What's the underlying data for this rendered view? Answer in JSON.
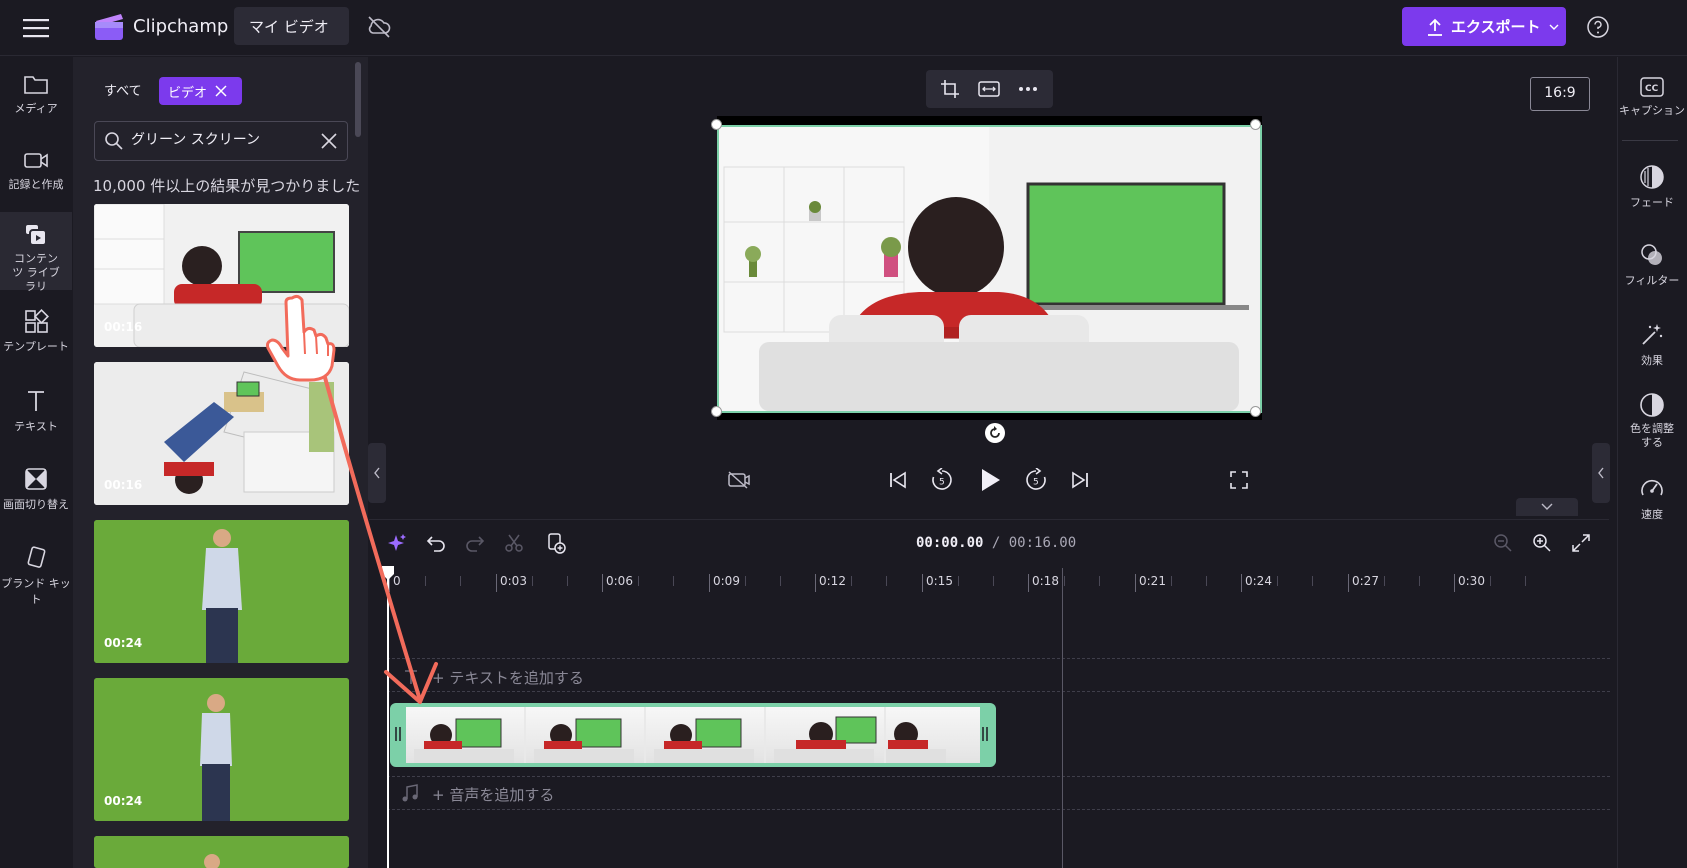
{
  "app": {
    "name": "Clipchamp",
    "project_title": "マイ ビデオ"
  },
  "header": {
    "export_label": "エクスポート"
  },
  "left_nav": [
    {
      "label": "メディア",
      "icon": "folder-icon"
    },
    {
      "label": "記録と作成",
      "icon": "camera-icon"
    },
    {
      "label": "コンテンツ ライブラリ",
      "icon": "content-library-icon",
      "active": true
    },
    {
      "label": "テンプレート",
      "icon": "template-icon"
    },
    {
      "label": "テキスト",
      "icon": "text-icon"
    },
    {
      "label": "画面切り替え",
      "icon": "transition-icon"
    },
    {
      "label": "ブランド キット",
      "icon": "brand-kit-icon"
    }
  ],
  "media_panel": {
    "filter_all": "すべて",
    "filter_video": "ビデオ",
    "search_value": "グリーン スクリーン",
    "results_text": "10,000 件以上の結果が見つかりました",
    "items": [
      {
        "duration": "00:16",
        "kind": "room"
      },
      {
        "duration": "00:16",
        "kind": "room"
      },
      {
        "duration": "00:24",
        "kind": "green"
      },
      {
        "duration": "00:24",
        "kind": "green"
      },
      {
        "duration": "",
        "kind": "green"
      }
    ]
  },
  "preview": {
    "aspect_ratio": "16:9"
  },
  "timeline": {
    "current_time": "00:00.00",
    "separator": " / ",
    "total_time": "00:16.00",
    "ticks": [
      "0",
      "0:03",
      "0:06",
      "0:09",
      "0:12",
      "0:15",
      "0:18",
      "0:21",
      "0:24",
      "0:27",
      "0:30"
    ],
    "add_text_label": "+ テキストを追加する",
    "add_audio_label": "+ 音声を追加する"
  },
  "right_panel": [
    {
      "label": "キャプション",
      "icon": "captions-icon"
    },
    {
      "label": "フェード",
      "icon": "fade-icon"
    },
    {
      "label": "フィルター",
      "icon": "filter-icon"
    },
    {
      "label": "効果",
      "icon": "effects-icon"
    },
    {
      "label": "色を調整する",
      "icon": "color-adjust-icon"
    },
    {
      "label": "速度",
      "icon": "speed-icon"
    }
  ],
  "colors": {
    "accent": "#7c3aed",
    "clip": "#7cd0a8",
    "annotation": "#f26b5b"
  }
}
